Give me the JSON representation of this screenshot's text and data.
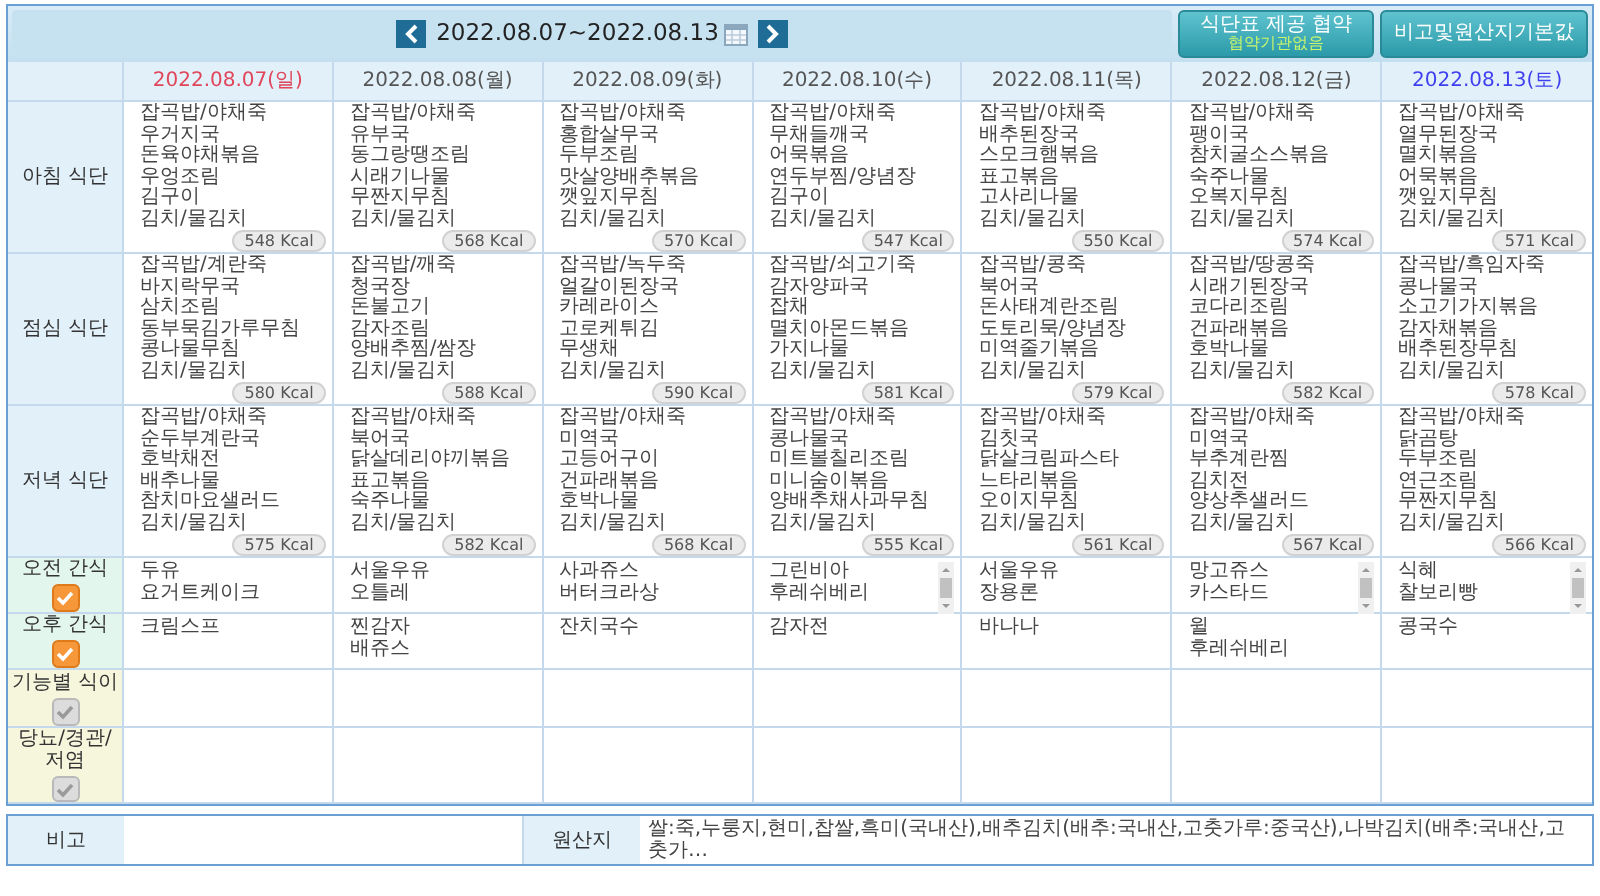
{
  "toolbar": {
    "date_range": "2022.08.07~2022.08.13",
    "agreement_button": {
      "label": "식단표 제공 협약",
      "sub": "협약기관없음"
    },
    "defaults_button": {
      "label": "비고및원산지기본값"
    }
  },
  "days": [
    {
      "date": "2022.08.07(일)",
      "color": "#e0455a"
    },
    {
      "date": "2022.08.08(월)",
      "color": "#555555"
    },
    {
      "date": "2022.08.09(화)",
      "color": "#555555"
    },
    {
      "date": "2022.08.10(수)",
      "color": "#555555"
    },
    {
      "date": "2022.08.11(목)",
      "color": "#555555"
    },
    {
      "date": "2022.08.12(금)",
      "color": "#555555"
    },
    {
      "date": "2022.08.13(토)",
      "color": "#3f3ff0"
    }
  ],
  "rows": [
    {
      "kind": "meal",
      "label": "아침 식단",
      "cells": [
        {
          "items": [
            "잡곡밥/야채죽",
            "우거지국",
            "돈육야채볶음",
            "우엉조림",
            "김구이",
            "김치/물김치"
          ],
          "kcal": "548 Kcal"
        },
        {
          "items": [
            "잡곡밥/야채죽",
            "유부국",
            "동그랑땡조림",
            "시래기나물",
            "무짠지무침",
            "김치/물김치"
          ],
          "kcal": "568 Kcal"
        },
        {
          "items": [
            "잡곡밥/야채죽",
            "홍합살무국",
            "두부조림",
            "맛살양배추볶음",
            "깻잎지무침",
            "김치/물김치"
          ],
          "kcal": "570 Kcal"
        },
        {
          "items": [
            "잡곡밥/야채죽",
            "무채들깨국",
            "어묵볶음",
            "연두부찜/양념장",
            "김구이",
            "김치/물김치"
          ],
          "kcal": "547 Kcal"
        },
        {
          "items": [
            "잡곡밥/야채죽",
            "배추된장국",
            "스모크햄볶음",
            "표고볶음",
            "고사리나물",
            "김치/물김치"
          ],
          "kcal": "550 Kcal"
        },
        {
          "items": [
            "잡곡밥/야채죽",
            "팽이국",
            "참치굴소스볶음",
            "숙주나물",
            "오복지무침",
            "김치/물김치"
          ],
          "kcal": "574 Kcal"
        },
        {
          "items": [
            "잡곡밥/야채죽",
            "열무된장국",
            "멸치볶음",
            "어묵볶음",
            "깻잎지무침",
            "김치/물김치"
          ],
          "kcal": "571 Kcal"
        }
      ]
    },
    {
      "kind": "meal",
      "label": "점심 식단",
      "cells": [
        {
          "items": [
            "잡곡밥/계란죽",
            "바지락무국",
            "삼치조림",
            "동부묵김가루무침",
            "콩나물무침",
            "김치/물김치"
          ],
          "kcal": "580 Kcal"
        },
        {
          "items": [
            "잡곡밥/깨죽",
            "청국장",
            "돈불고기",
            "감자조림",
            "양배추찜/쌈장",
            "김치/물김치"
          ],
          "kcal": "588 Kcal"
        },
        {
          "items": [
            "잡곡밥/녹두죽",
            "얼갈이된장국",
            "카레라이스",
            "고로케튀김",
            "무생채",
            "김치/물김치"
          ],
          "kcal": "590 Kcal"
        },
        {
          "items": [
            "잡곡밥/쇠고기죽",
            "감자양파국",
            "잡채",
            "멸치아몬드볶음",
            "가지나물",
            "김치/물김치"
          ],
          "kcal": "581 Kcal"
        },
        {
          "items": [
            "잡곡밥/콩죽",
            "북어국",
            "돈사태계란조림",
            "도토리묵/양념장",
            "미역줄기볶음",
            "김치/물김치"
          ],
          "kcal": "579 Kcal"
        },
        {
          "items": [
            "잡곡밥/땅콩죽",
            "시래기된장국",
            "코다리조림",
            "건파래볶음",
            "호박나물",
            "김치/물김치"
          ],
          "kcal": "582 Kcal"
        },
        {
          "items": [
            "잡곡밥/흑임자죽",
            "콩나물국",
            "소고기가지볶음",
            "감자채볶음",
            "배추된장무침",
            "김치/물김치"
          ],
          "kcal": "578 Kcal"
        }
      ]
    },
    {
      "kind": "meal",
      "label": "저녁 식단",
      "cells": [
        {
          "items": [
            "잡곡밥/야채죽",
            "순두부계란국",
            "호박채전",
            "배추나물",
            "참치마요샐러드",
            "김치/물김치"
          ],
          "kcal": "575 Kcal"
        },
        {
          "items": [
            "잡곡밥/야채죽",
            "북어국",
            "닭살데리야끼볶음",
            "표고볶음",
            "숙주나물",
            "김치/물김치"
          ],
          "kcal": "582 Kcal"
        },
        {
          "items": [
            "잡곡밥/야채죽",
            "미역국",
            "고등어구이",
            "건파래볶음",
            "호박나물",
            "김치/물김치"
          ],
          "kcal": "568 Kcal"
        },
        {
          "items": [
            "잡곡밥/야채죽",
            "콩나물국",
            "미트볼칠리조림",
            "미니숨이볶음",
            "양배추채사과무침",
            "김치/물김치"
          ],
          "kcal": "555 Kcal"
        },
        {
          "items": [
            "잡곡밥/야채죽",
            "김칫국",
            "닭살크림파스타",
            "느타리볶음",
            "오이지무침",
            "김치/물김치"
          ],
          "kcal": "561 Kcal"
        },
        {
          "items": [
            "잡곡밥/야채죽",
            "미역국",
            "부추계란찜",
            "김치전",
            "양상추샐러드",
            "김치/물김치"
          ],
          "kcal": "567 Kcal"
        },
        {
          "items": [
            "잡곡밥/야채죽",
            "닭곰탕",
            "두부조림",
            "연근조림",
            "무짠지무침",
            "김치/물김치"
          ],
          "kcal": "566 Kcal"
        }
      ]
    },
    {
      "kind": "snack",
      "label": "오전 간식",
      "checked": true,
      "disabled": false,
      "cells": [
        {
          "items": [
            "두유",
            "요거트케이크"
          ],
          "scrollable": false
        },
        {
          "items": [
            "서울우유",
            "오틀레"
          ],
          "scrollable": false
        },
        {
          "items": [
            "사과쥬스",
            "버터크라상"
          ],
          "scrollable": false
        },
        {
          "items": [
            "그린비아",
            "후레쉬베리"
          ],
          "scrollable": true
        },
        {
          "items": [
            "서울우유",
            "장용론"
          ],
          "scrollable": false
        },
        {
          "items": [
            "망고쥬스",
            "카스타드"
          ],
          "scrollable": true
        },
        {
          "items": [
            "식혜",
            "찰보리빵"
          ],
          "scrollable": true
        }
      ]
    },
    {
      "kind": "snack",
      "label": "오후 간식",
      "checked": true,
      "disabled": false,
      "cells": [
        {
          "items": [
            "크림스프"
          ],
          "scrollable": false
        },
        {
          "items": [
            "찐감자",
            "배쥬스"
          ],
          "scrollable": false
        },
        {
          "items": [
            "잔치국수"
          ],
          "scrollable": false
        },
        {
          "items": [
            "감자전"
          ],
          "scrollable": false
        },
        {
          "items": [
            "바나나"
          ],
          "scrollable": false
        },
        {
          "items": [
            "윌",
            "후레쉬베리"
          ],
          "scrollable": false
        },
        {
          "items": [
            "콩국수"
          ],
          "scrollable": false
        }
      ]
    },
    {
      "kind": "diet",
      "label": "기능별 식이",
      "checked": true,
      "disabled": true
    },
    {
      "kind": "diet",
      "label": "당뇨/경관/저염",
      "checked": true,
      "disabled": true
    }
  ],
  "remarks": {
    "label": "비고"
  },
  "origin": {
    "label": "원산지",
    "text": "쌀:죽,누룽지,현미,찹쌀,흑미(국내산),배추김치(배추:국내산,고춧가루:중국산),나박김치(배추:국내산,고춧가…"
  }
}
